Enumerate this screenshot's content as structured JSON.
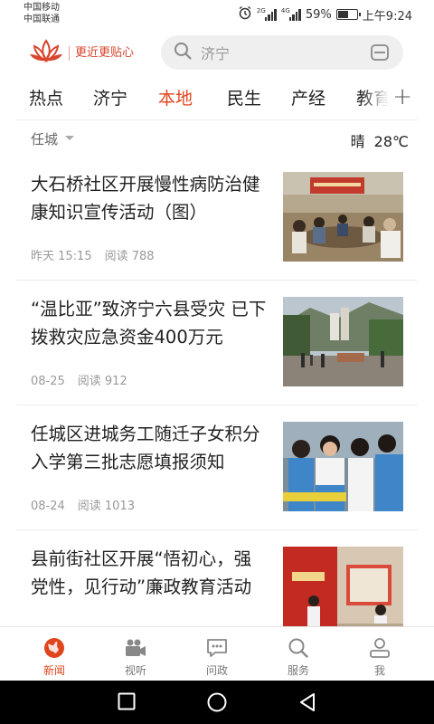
{
  "status_bar": {
    "carrier_1": "中国移动",
    "carrier_2": "中国联通",
    "net_1": "2G",
    "net_2": "4G",
    "battery": "59%",
    "battery_level": 0.59,
    "time": "上午9:24"
  },
  "header": {
    "slogan": "更近更贴心",
    "search_placeholder": "济宁",
    "brand_color": "#d9442e"
  },
  "tabs": [
    {
      "label": "热点",
      "active": false
    },
    {
      "label": "济宁",
      "active": false
    },
    {
      "label": "本地",
      "active": true
    },
    {
      "label": "民生",
      "active": false
    },
    {
      "label": "产经",
      "active": false
    },
    {
      "label": "教育",
      "active": false
    }
  ],
  "accent_color": "#e0461e",
  "location": {
    "name": "任城",
    "weather": "晴",
    "temperature": "28℃"
  },
  "news": [
    {
      "title": "大石桥社区开展慢性病防治健康知识宣传活动（图）",
      "date": "昨天 15:15",
      "reads": "阅读 788",
      "thumb": "meeting-room-photo"
    },
    {
      "title": "“温比亚”致济宁六县受灾 已下拨救灾应急资金400万元",
      "date": "08-25",
      "reads": "阅读 912",
      "thumb": "flooded-street-photo"
    },
    {
      "title": "任城区进城务工随迁子女积分入学第三批志愿填报须知",
      "date": "08-24",
      "reads": "阅读 1013",
      "thumb": "schoolchildren-photo"
    },
    {
      "title": "县前街社区开展“悟初心，强党性，见行动”廉政教育活动",
      "date": "",
      "reads": "",
      "thumb": "exhibition-hall-photo"
    }
  ],
  "bottom_nav": [
    {
      "label": "新闻",
      "icon": "globe-icon",
      "active": true
    },
    {
      "label": "视听",
      "icon": "video-camera-icon",
      "active": false
    },
    {
      "label": "问政",
      "icon": "chat-bubble-icon",
      "active": false
    },
    {
      "label": "服务",
      "icon": "search-icon",
      "active": false
    },
    {
      "label": "我",
      "icon": "user-icon",
      "active": false
    }
  ],
  "system_nav": [
    "square-icon",
    "circle-icon",
    "back-triangle-icon"
  ]
}
